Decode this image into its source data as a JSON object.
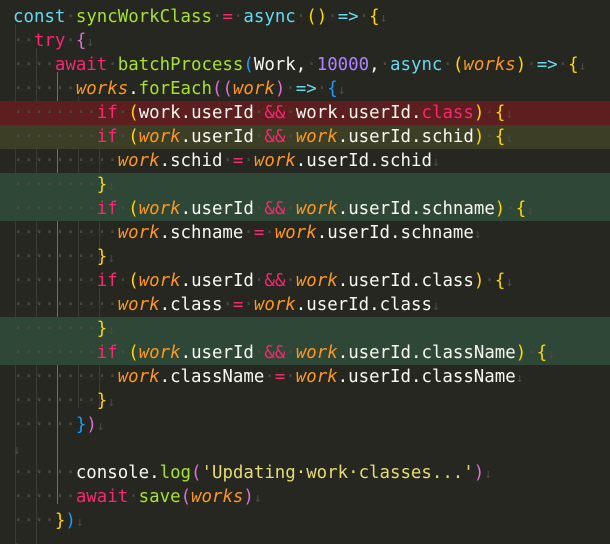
{
  "editor": {
    "lines": [
      {
        "hl": "",
        "tokens": [
          [
            "decl",
            "const"
          ],
          [
            "ws",
            "·"
          ],
          [
            "fn",
            "syncWorkClass"
          ],
          [
            "ws",
            "·"
          ],
          [
            "op",
            "="
          ],
          [
            "ws",
            "·"
          ],
          [
            "decl",
            "async"
          ],
          [
            "ws",
            "·"
          ],
          [
            "b1",
            "()"
          ],
          [
            "ws",
            "·"
          ],
          [
            "decl",
            "=>"
          ],
          [
            "ws",
            "·"
          ],
          [
            "b1",
            "{"
          ],
          [
            "eol",
            "↓"
          ]
        ]
      },
      {
        "hl": "",
        "tokens": [
          [
            "ws",
            "··"
          ],
          [
            "kw",
            "try"
          ],
          [
            "ws",
            "·"
          ],
          [
            "b2",
            "{"
          ],
          [
            "eol",
            "↓"
          ]
        ]
      },
      {
        "hl": "",
        "tokens": [
          [
            "ws",
            "····"
          ],
          [
            "kw",
            "await"
          ],
          [
            "ws",
            "·"
          ],
          [
            "fn",
            "batchProcess"
          ],
          [
            "b3",
            "("
          ],
          [
            "var",
            "Work"
          ],
          [
            "punc",
            ","
          ],
          [
            "ws",
            "·"
          ],
          [
            "num",
            "10000"
          ],
          [
            "punc",
            ","
          ],
          [
            "ws",
            "·"
          ],
          [
            "decl",
            "async"
          ],
          [
            "ws",
            "·"
          ],
          [
            "b1",
            "("
          ],
          [
            "param",
            "works"
          ],
          [
            "b1",
            ")"
          ],
          [
            "ws",
            "·"
          ],
          [
            "decl",
            "=>"
          ],
          [
            "ws",
            "·"
          ],
          [
            "b1",
            "{"
          ],
          [
            "eol",
            "↓"
          ]
        ]
      },
      {
        "hl": "",
        "tokens": [
          [
            "ws",
            "······"
          ],
          [
            "param",
            "works"
          ],
          [
            "punc",
            "."
          ],
          [
            "fn",
            "forEach"
          ],
          [
            "b2",
            "(("
          ],
          [
            "param",
            "work"
          ],
          [
            "b2",
            ")"
          ],
          [
            "ws",
            "·"
          ],
          [
            "decl",
            "=>"
          ],
          [
            "ws",
            "·"
          ],
          [
            "b3",
            "{"
          ],
          [
            "eol",
            "↓"
          ]
        ]
      },
      {
        "hl": "red",
        "tokens": [
          [
            "ws",
            "········"
          ],
          [
            "kw",
            "if"
          ],
          [
            "ws",
            "·"
          ],
          [
            "b1",
            "("
          ],
          [
            "var",
            "work"
          ],
          [
            "punc",
            "."
          ],
          [
            "var",
            "userId"
          ],
          [
            "ws",
            "·"
          ],
          [
            "op",
            "&&"
          ],
          [
            "ws",
            "·"
          ],
          [
            "var",
            "work"
          ],
          [
            "punc",
            "."
          ],
          [
            "var",
            "userId"
          ],
          [
            "punc",
            "."
          ],
          [
            "kw",
            "class"
          ],
          [
            "b1",
            ")"
          ],
          [
            "ws",
            "·"
          ],
          [
            "b1",
            "{"
          ],
          [
            "eol",
            "↓"
          ]
        ]
      },
      {
        "hl": "olive",
        "tokens": [
          [
            "ws",
            "········"
          ],
          [
            "kw",
            "if"
          ],
          [
            "ws",
            "·"
          ],
          [
            "b1",
            "("
          ],
          [
            "param",
            "work"
          ],
          [
            "punc",
            "."
          ],
          [
            "var",
            "userId"
          ],
          [
            "ws",
            "·"
          ],
          [
            "op",
            "&&"
          ],
          [
            "ws",
            "·"
          ],
          [
            "param",
            "work"
          ],
          [
            "punc",
            "."
          ],
          [
            "var",
            "userId"
          ],
          [
            "punc",
            "."
          ],
          [
            "var",
            "schid"
          ],
          [
            "b1",
            ")"
          ],
          [
            "ws",
            "·"
          ],
          [
            "b1",
            "{"
          ],
          [
            "eol",
            "↓"
          ]
        ]
      },
      {
        "hl": "",
        "tokens": [
          [
            "ws",
            "··········"
          ],
          [
            "param",
            "work"
          ],
          [
            "punc",
            "."
          ],
          [
            "var",
            "schid"
          ],
          [
            "ws",
            "·"
          ],
          [
            "op",
            "="
          ],
          [
            "ws",
            "·"
          ],
          [
            "param",
            "work"
          ],
          [
            "punc",
            "."
          ],
          [
            "var",
            "userId"
          ],
          [
            "punc",
            "."
          ],
          [
            "var",
            "schid"
          ],
          [
            "eol",
            "↓"
          ]
        ]
      },
      {
        "hl": "green",
        "tokens": [
          [
            "ws",
            "········"
          ],
          [
            "b1",
            "}"
          ],
          [
            "eol",
            "↓"
          ]
        ]
      },
      {
        "hl": "green",
        "tokens": [
          [
            "ws",
            "········"
          ],
          [
            "kw",
            "if"
          ],
          [
            "ws",
            "·"
          ],
          [
            "b1",
            "("
          ],
          [
            "param",
            "work"
          ],
          [
            "punc",
            "."
          ],
          [
            "var",
            "userId"
          ],
          [
            "ws",
            "·"
          ],
          [
            "op",
            "&&"
          ],
          [
            "ws",
            "·"
          ],
          [
            "param",
            "work"
          ],
          [
            "punc",
            "."
          ],
          [
            "var",
            "userId"
          ],
          [
            "punc",
            "."
          ],
          [
            "var",
            "schname"
          ],
          [
            "b1",
            ")"
          ],
          [
            "ws",
            "·"
          ],
          [
            "b1",
            "{"
          ],
          [
            "eol",
            "↓"
          ]
        ]
      },
      {
        "hl": "",
        "tokens": [
          [
            "ws",
            "··········"
          ],
          [
            "param",
            "work"
          ],
          [
            "punc",
            "."
          ],
          [
            "var",
            "schname"
          ],
          [
            "ws",
            "·"
          ],
          [
            "op",
            "="
          ],
          [
            "ws",
            "·"
          ],
          [
            "param",
            "work"
          ],
          [
            "punc",
            "."
          ],
          [
            "var",
            "userId"
          ],
          [
            "punc",
            "."
          ],
          [
            "var",
            "schname"
          ],
          [
            "eol",
            "↓"
          ]
        ]
      },
      {
        "hl": "",
        "tokens": [
          [
            "ws",
            "········"
          ],
          [
            "b1",
            "}"
          ],
          [
            "eol",
            "↓"
          ]
        ]
      },
      {
        "hl": "",
        "tokens": [
          [
            "ws",
            "········"
          ],
          [
            "kw",
            "if"
          ],
          [
            "ws",
            "·"
          ],
          [
            "b1",
            "("
          ],
          [
            "param",
            "work"
          ],
          [
            "punc",
            "."
          ],
          [
            "var",
            "userId"
          ],
          [
            "ws",
            "·"
          ],
          [
            "op",
            "&&"
          ],
          [
            "ws",
            "·"
          ],
          [
            "param",
            "work"
          ],
          [
            "punc",
            "."
          ],
          [
            "var",
            "userId"
          ],
          [
            "punc",
            "."
          ],
          [
            "var",
            "class"
          ],
          [
            "b1",
            ")"
          ],
          [
            "ws",
            "·"
          ],
          [
            "b1",
            "{"
          ],
          [
            "eol",
            "↓"
          ]
        ]
      },
      {
        "hl": "",
        "tokens": [
          [
            "ws",
            "··········"
          ],
          [
            "param",
            "work"
          ],
          [
            "punc",
            "."
          ],
          [
            "var",
            "class"
          ],
          [
            "ws",
            "·"
          ],
          [
            "op",
            "="
          ],
          [
            "ws",
            "·"
          ],
          [
            "param",
            "work"
          ],
          [
            "punc",
            "."
          ],
          [
            "var",
            "userId"
          ],
          [
            "punc",
            "."
          ],
          [
            "var",
            "class"
          ],
          [
            "eol",
            "↓"
          ]
        ]
      },
      {
        "hl": "green",
        "tokens": [
          [
            "ws",
            "········"
          ],
          [
            "b1",
            "}"
          ],
          [
            "eol",
            "↓"
          ]
        ]
      },
      {
        "hl": "green",
        "tokens": [
          [
            "ws",
            "········"
          ],
          [
            "kw",
            "if"
          ],
          [
            "ws",
            "·"
          ],
          [
            "b1",
            "("
          ],
          [
            "param",
            "work"
          ],
          [
            "punc",
            "."
          ],
          [
            "var",
            "userId"
          ],
          [
            "ws",
            "·"
          ],
          [
            "op",
            "&&"
          ],
          [
            "ws",
            "·"
          ],
          [
            "param",
            "work"
          ],
          [
            "punc",
            "."
          ],
          [
            "var",
            "userId"
          ],
          [
            "punc",
            "."
          ],
          [
            "var",
            "className"
          ],
          [
            "b1",
            ")"
          ],
          [
            "ws",
            "·"
          ],
          [
            "b1",
            "{"
          ],
          [
            "eol",
            "↓"
          ]
        ]
      },
      {
        "hl": "",
        "tokens": [
          [
            "ws",
            "··········"
          ],
          [
            "param",
            "work"
          ],
          [
            "punc",
            "."
          ],
          [
            "var",
            "className"
          ],
          [
            "ws",
            "·"
          ],
          [
            "op",
            "="
          ],
          [
            "ws",
            "·"
          ],
          [
            "param",
            "work"
          ],
          [
            "punc",
            "."
          ],
          [
            "var",
            "userId"
          ],
          [
            "punc",
            "."
          ],
          [
            "var",
            "className"
          ],
          [
            "eol",
            "↓"
          ]
        ]
      },
      {
        "hl": "",
        "tokens": [
          [
            "ws",
            "········"
          ],
          [
            "b1",
            "}"
          ],
          [
            "eol",
            "↓"
          ]
        ]
      },
      {
        "hl": "",
        "tokens": [
          [
            "ws",
            "······"
          ],
          [
            "b3",
            "}"
          ],
          [
            "b2",
            ")"
          ],
          [
            "eol",
            "↓"
          ]
        ]
      },
      {
        "hl": "",
        "tokens": [
          [
            "ws",
            ""
          ],
          [
            "eol",
            "↓"
          ]
        ]
      },
      {
        "hl": "",
        "tokens": [
          [
            "ws",
            "······"
          ],
          [
            "var",
            "console"
          ],
          [
            "punc",
            "."
          ],
          [
            "fn",
            "log"
          ],
          [
            "b2",
            "("
          ],
          [
            "str",
            "'Updating·work·classes...'"
          ],
          [
            "b2",
            ")"
          ],
          [
            "eol",
            "↓"
          ]
        ]
      },
      {
        "hl": "",
        "tokens": [
          [
            "ws",
            "······"
          ],
          [
            "kw",
            "await"
          ],
          [
            "ws",
            "·"
          ],
          [
            "fn",
            "save"
          ],
          [
            "b2",
            "("
          ],
          [
            "param",
            "works"
          ],
          [
            "b2",
            ")"
          ],
          [
            "eol",
            "↓"
          ]
        ]
      },
      {
        "hl": "",
        "tokens": [
          [
            "ws",
            "····"
          ],
          [
            "b1",
            "}"
          ],
          [
            "b3",
            ")"
          ],
          [
            "eol",
            "↓"
          ]
        ]
      },
      {
        "hl": "",
        "tokens": [
          [
            "ws",
            ""
          ],
          [
            "eol",
            "↓"
          ]
        ]
      }
    ]
  }
}
